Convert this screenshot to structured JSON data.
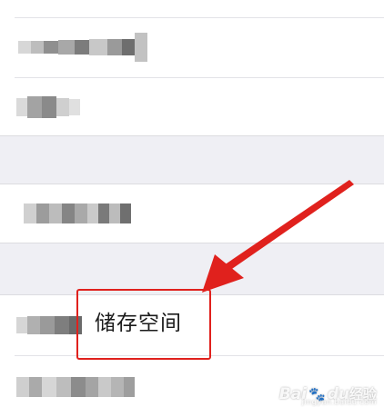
{
  "settings_list": {
    "highlighted_item_label": "储存空间"
  },
  "watermark": {
    "brand": "Bai",
    "paw_icon": "paw-icon",
    "brand_suffix": "du",
    "sub": "经验",
    "url": "jingyan.baidu.com"
  },
  "colors": {
    "annotation_red": "#e0211d",
    "page_background": "#efeff4",
    "row_background": "#ffffff"
  }
}
